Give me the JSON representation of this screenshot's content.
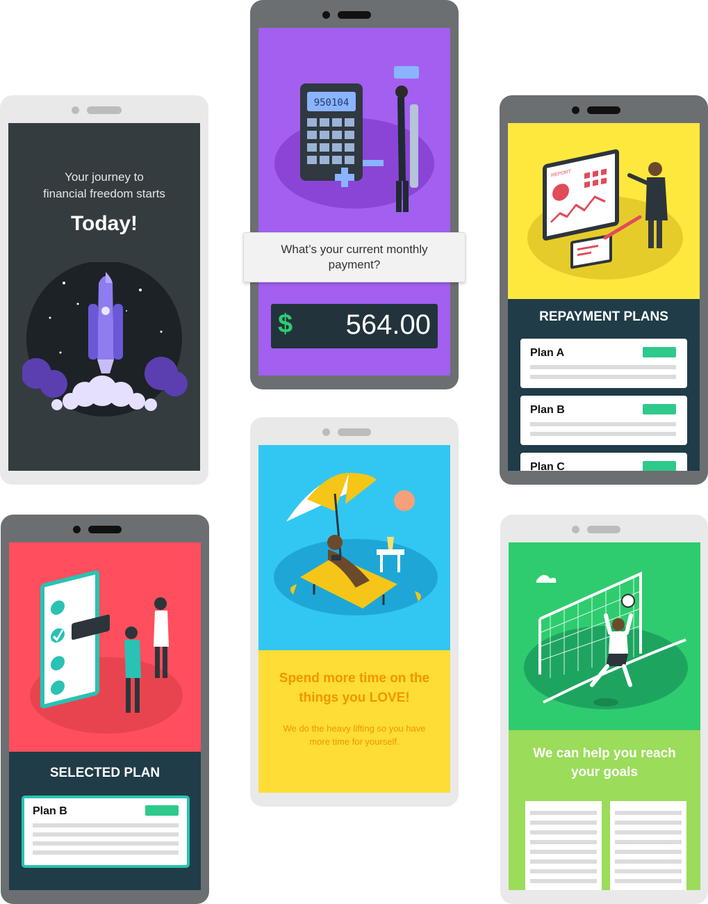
{
  "screens": {
    "launch": {
      "intro": "Your journey to\nfinancial freedom starts",
      "headline": "Today!"
    },
    "payment": {
      "question": "What’s your current monthly payment?",
      "currency": "$",
      "amount": "564.00",
      "calculator_display": "950104"
    },
    "plans": {
      "title": "REPAYMENT PLANS",
      "items": [
        {
          "label": "Plan A"
        },
        {
          "label": "Plan B"
        },
        {
          "label": "Plan C"
        }
      ],
      "report_label": "REPORT"
    },
    "beach": {
      "headline": "Spend more time on the things you LOVE!",
      "body": "We do the heavy lifting so you have more time for yourself."
    },
    "selected": {
      "title": "SELECTED PLAN",
      "plan": "Plan B"
    },
    "goals": {
      "headline": "We can help you reach your goals"
    }
  },
  "colors": {
    "launch_bg": "#343c40",
    "payment_bg": "#a35ff0",
    "plans_bg": "#ffe83d",
    "panel_dark": "#1f3c48",
    "beach_top": "#32c7f2",
    "beach_bottom": "#fddd36",
    "beach_text": "#f29500",
    "selected_bg": "#ff4f5e",
    "goals_top": "#2ecc6f",
    "goals_bottom": "#9bdc5a",
    "accent_green": "#2ec98b"
  }
}
